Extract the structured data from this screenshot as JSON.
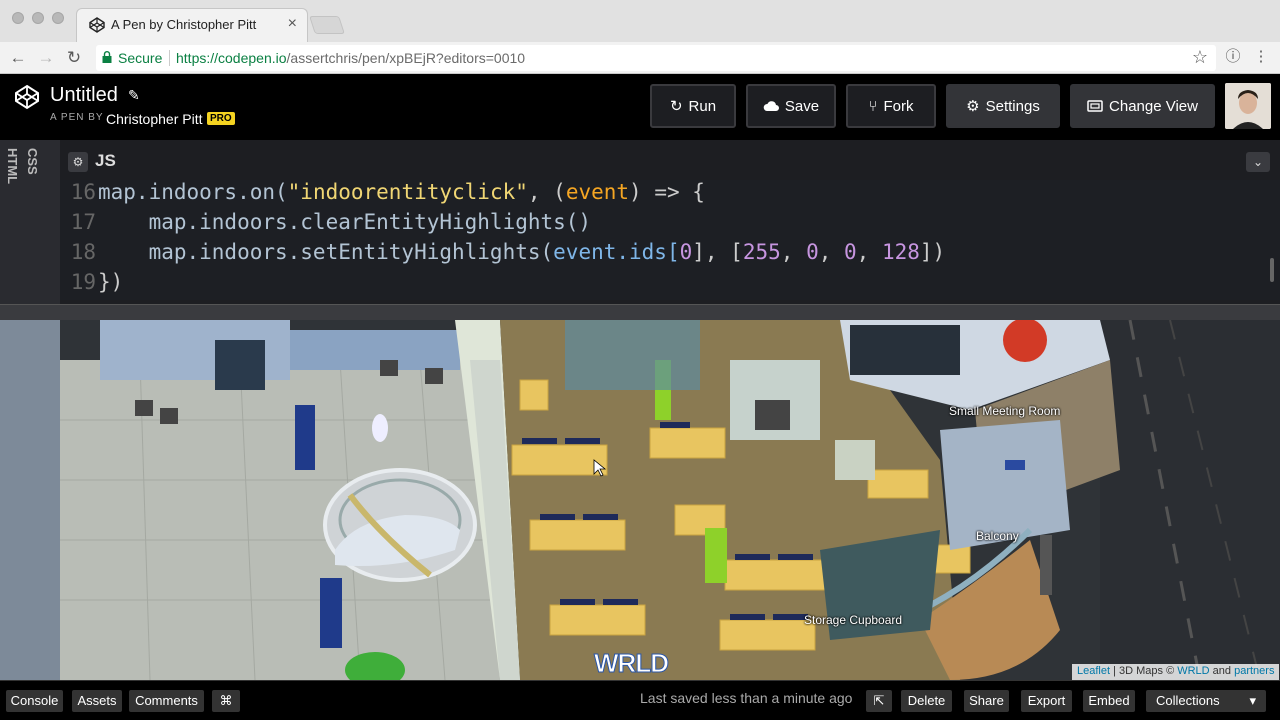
{
  "browser": {
    "tab_title": "A Pen by Christopher Pitt",
    "tab_close": "×",
    "secure_label": "Secure",
    "url_scheme_host": "https://codepen.io",
    "url_rest": "/assertchris/pen/xpBEjR?editors=0010",
    "back": "←",
    "forward": "→",
    "reload": "↻",
    "star": "☆",
    "info": "ⓘ",
    "menu": "⋮"
  },
  "header": {
    "pen_title": "Untitled",
    "pen_by": "A PEN BY",
    "author": "Christopher Pitt",
    "pro_badge": "PRO",
    "run_label": "Run",
    "save_label": "Save",
    "fork_label": "Fork",
    "settings_label": "Settings",
    "change_view_label": "Change View"
  },
  "editor": {
    "side_tabs": [
      "HTML",
      "CSS"
    ],
    "active_panel": "JS",
    "lines": [
      {
        "num": "16"
      },
      {
        "num": "17"
      },
      {
        "num": "18"
      },
      {
        "num": "19"
      }
    ],
    "tokens": {
      "l16_a": "map.indoors.on(",
      "l16_b": "\"indoorentityclick\"",
      "l16_c": ", (",
      "l16_d": "event",
      "l16_e": ") => {",
      "l17": "    map.indoors.clearEntityHighlights()",
      "l18_a": "    map.indoors.setEntityHighlights(",
      "l18_b": "event",
      "l18_c": ".ids[",
      "l18_d": "0",
      "l18_e": "], [",
      "l18_f": "255",
      "l18_g": ", ",
      "l18_h": "0",
      "l18_i": ", ",
      "l18_j": "0",
      "l18_k": ", ",
      "l18_l": "128",
      "l18_m": "])",
      "l19": "})"
    }
  },
  "map": {
    "labels": {
      "small_meeting_room": "Small Meeting Room",
      "balcony": "Balcony",
      "storage_cupboard": "Storage Cupboard"
    },
    "wrld_logo": "WRLD",
    "attribution": {
      "leaflet": "Leaflet",
      "sep": " | 3D Maps © ",
      "wrld": "WRLD",
      "and": " and ",
      "partners": "partners"
    }
  },
  "footer": {
    "console": "Console",
    "assets": "Assets",
    "comments": "Comments",
    "shortcut": "⌘",
    "saved_status": "Last saved less than a minute ago",
    "external": "⇱",
    "delete": "Delete",
    "share": "Share",
    "export": "Export",
    "embed": "Embed",
    "collections": "Collections",
    "collections_caret": "▾"
  }
}
